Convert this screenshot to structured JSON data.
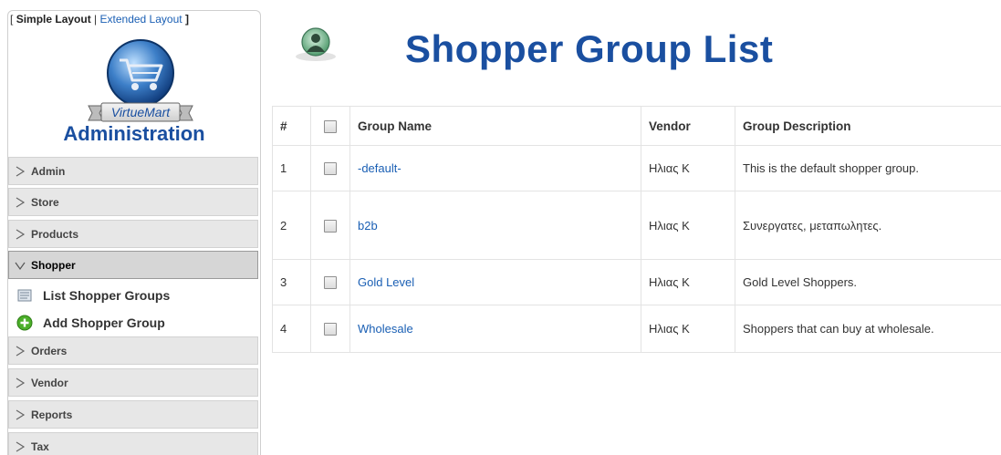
{
  "sidebar": {
    "layout_switch": {
      "open_bracket": "[",
      "simple": "Simple Layout",
      "separator": "|",
      "extended": "Extended Layout",
      "close_bracket": "]"
    },
    "logo_text": "VirtueMart",
    "admin_title": "Administration",
    "menu": [
      {
        "label": "Admin",
        "state": "collapsed"
      },
      {
        "label": "Store",
        "state": "collapsed"
      },
      {
        "label": "Products",
        "state": "collapsed"
      },
      {
        "label": "Shopper",
        "state": "expanded"
      },
      {
        "label": "Orders",
        "state": "collapsed"
      },
      {
        "label": "Vendor",
        "state": "collapsed"
      },
      {
        "label": "Reports",
        "state": "collapsed"
      },
      {
        "label": "Tax",
        "state": "collapsed"
      }
    ],
    "shopper_submenu": [
      {
        "label": "List Shopper Groups",
        "icon": "list-icon"
      },
      {
        "label": "Add Shopper Group",
        "icon": "add-icon"
      }
    ]
  },
  "main": {
    "title": "Shopper Group List",
    "table": {
      "headers": [
        "#",
        "",
        "Group Name",
        "Vendor",
        "Group Description"
      ],
      "rows": [
        {
          "num": "1",
          "name": "-default-",
          "vendor": "Ηλιας Κ",
          "description": "This is the default shopper group."
        },
        {
          "num": "2",
          "name": "b2b",
          "vendor": "Ηλιας Κ",
          "description": "Συνεργατες,  μεταπωλητες."
        },
        {
          "num": "3",
          "name": "Gold Level",
          "vendor": "Ηλιας Κ",
          "description": "Gold Level Shoppers."
        },
        {
          "num": "4",
          "name": "Wholesale",
          "vendor": "Ηλιας Κ",
          "description": "Shoppers that can buy at wholesale."
        }
      ]
    }
  },
  "colors": {
    "title_blue": "#1a4fa0",
    "link_blue": "#1a5fb4",
    "menu_bg": "#e7e7e7",
    "menu_open_bg": "#d6d6d6"
  }
}
